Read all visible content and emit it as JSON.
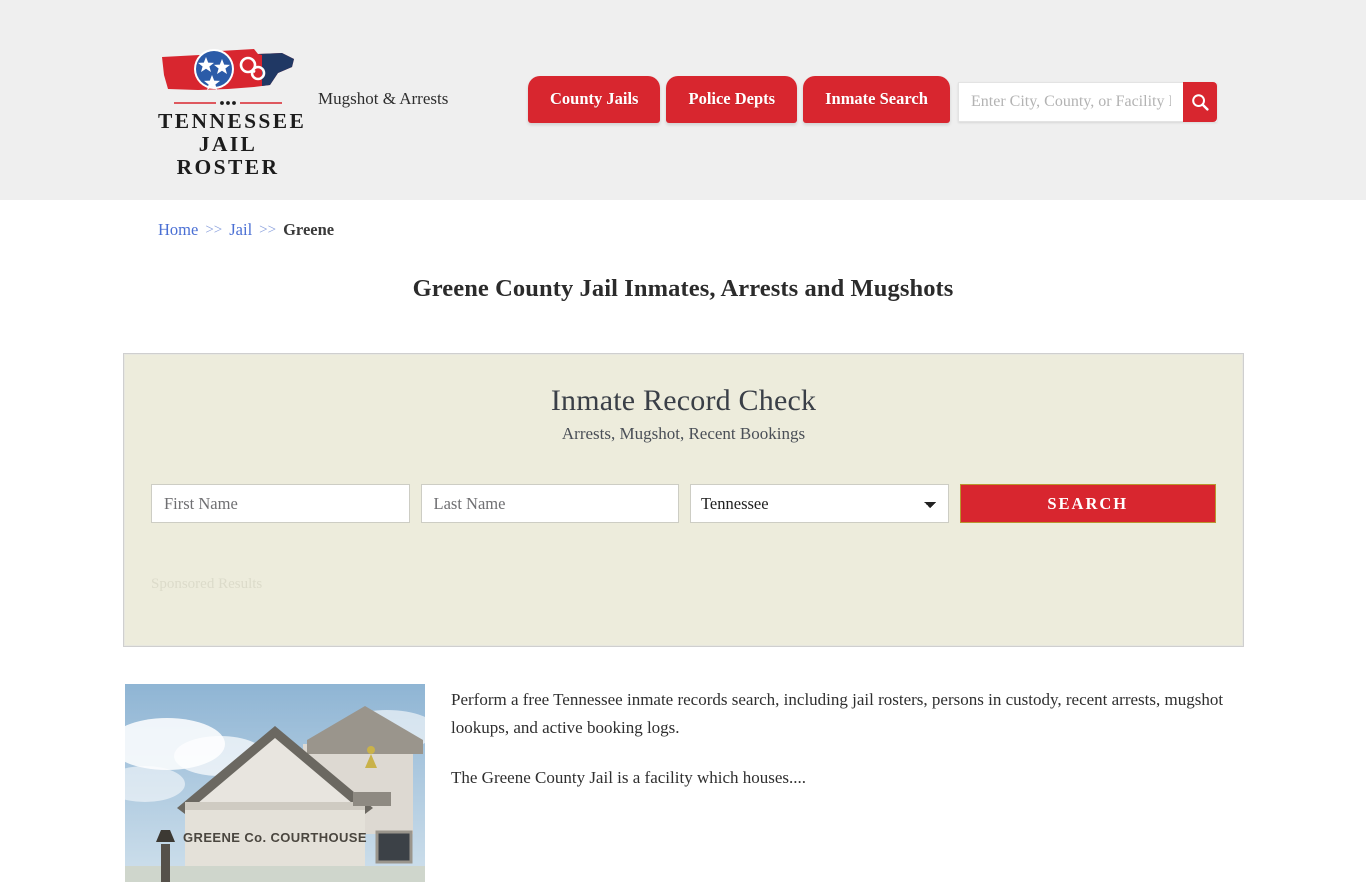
{
  "header": {
    "logo": {
      "line1": "TENNESSEE",
      "line2": "JAIL ROSTER",
      "icon": "tennessee-state-handcuffs-logo"
    },
    "tagline": "Mugshot & Arrests",
    "nav": [
      {
        "label": "County Jails"
      },
      {
        "label": "Police Depts"
      },
      {
        "label": "Inmate Search"
      }
    ],
    "search": {
      "placeholder": "Enter City, County, or Facility Name",
      "value": "",
      "icon": "search-icon"
    }
  },
  "breadcrumb": {
    "home": "Home",
    "sep1": ">>",
    "jail": "Jail",
    "sep2": ">>",
    "current": "Greene"
  },
  "page_title": "Greene County Jail Inmates, Arrests and Mugshots",
  "panel": {
    "title": "Inmate Record Check",
    "subtitle": "Arrests, Mugshot, Recent Bookings",
    "first_name_placeholder": "First Name",
    "first_name_value": "",
    "last_name_placeholder": "Last Name",
    "last_name_value": "",
    "state_selected": "Tennessee",
    "state_options": [
      "Tennessee"
    ],
    "search_button": "SEARCH",
    "sponsored_label": "Sponsored Results"
  },
  "article": {
    "image_caption": "GREENE Co. COURTHOUSE",
    "paragraph1": "Perform a free Tennessee inmate records search, including jail rosters, persons in custody, recent arrests, mugshot lookups, and active booking logs.",
    "paragraph2": "The Greene County Jail is a facility which houses...."
  },
  "colors": {
    "brand_red": "#d8262f",
    "header_bg": "#efefef",
    "panel_bg": "#edecdc",
    "link_blue": "#4a6fd4",
    "logo_navy": "#203864"
  }
}
